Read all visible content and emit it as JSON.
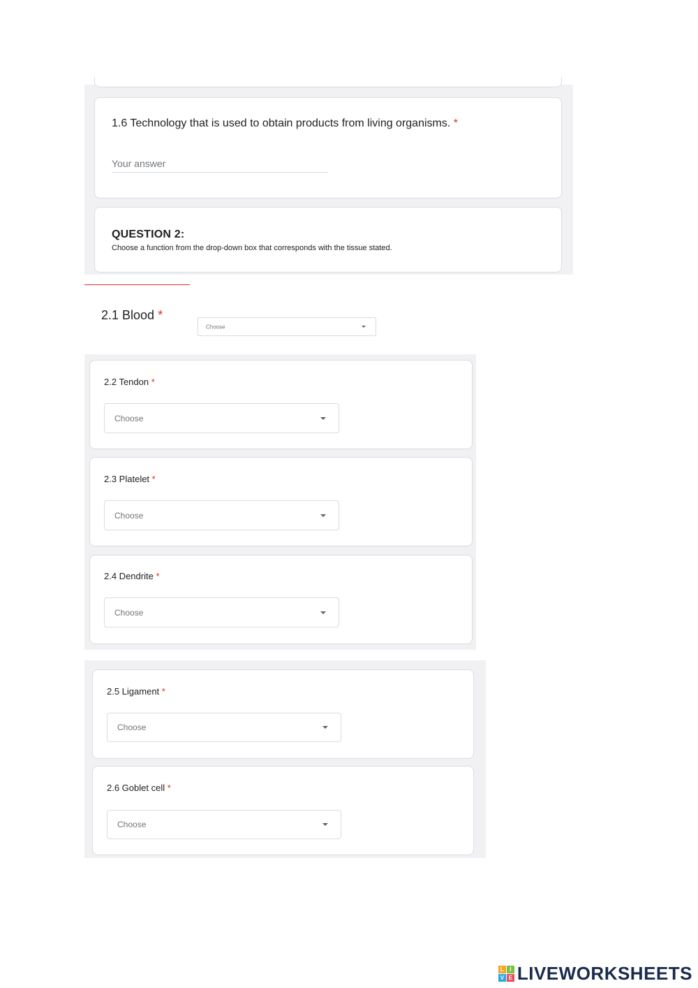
{
  "q16": {
    "title": "1.6 Technology that is used to obtain products from living organisms.",
    "required_mark": "*",
    "placeholder": "Your answer"
  },
  "question2": {
    "heading": "QUESTION 2:",
    "description": "Choose a function from the drop-down box that corresponds with the tissue stated."
  },
  "items": [
    {
      "label": "2.1 Blood",
      "required_mark": "*",
      "selected": "Choose"
    },
    {
      "label": "2.2 Tendon",
      "required_mark": "*",
      "selected": "Choose"
    },
    {
      "label": "2.3 Platelet",
      "required_mark": "*",
      "selected": "Choose"
    },
    {
      "label": "2.4 Dendrite",
      "required_mark": "*",
      "selected": "Choose"
    },
    {
      "label": "2.5 Ligament",
      "required_mark": "*",
      "selected": "Choose"
    },
    {
      "label": "2.6 Goblet cell",
      "required_mark": "*",
      "selected": "Choose"
    }
  ],
  "branding": {
    "logo_text": "LIVEWORKSHEETS",
    "mark_letters": [
      "L",
      "I",
      "V",
      "E"
    ]
  },
  "colors": {
    "required": "#d93025",
    "panel_bg": "#f1f1f4",
    "divider_accent": "#d93025"
  }
}
